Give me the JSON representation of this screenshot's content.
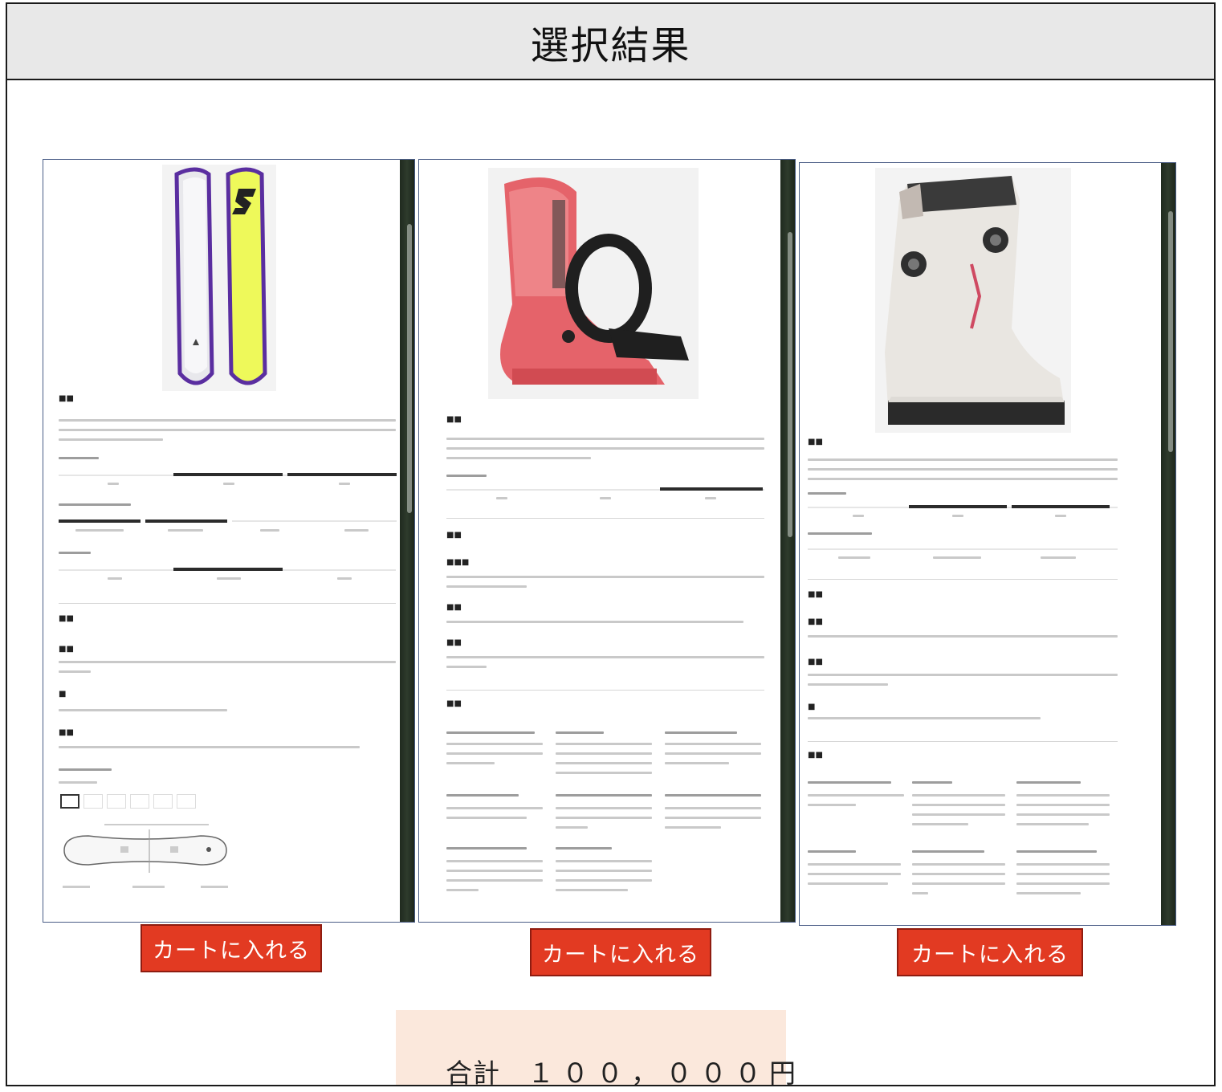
{
  "page": {
    "title": "選択結果"
  },
  "products": [
    {
      "type": "snowboard",
      "cart_button_label": "カートに入れる"
    },
    {
      "type": "binding",
      "cart_button_label": "カートに入れる"
    },
    {
      "type": "boot",
      "cart_button_label": "カートに入れる"
    }
  ],
  "total": {
    "label": "合計",
    "value": "１００，０００円"
  },
  "colors": {
    "header_bg": "#e8e8e8",
    "cart_button": "#e23a22",
    "total_bg": "#fbe8dc",
    "panel_border": "#4a5d86",
    "scrollbar": "#2e3b2c"
  }
}
